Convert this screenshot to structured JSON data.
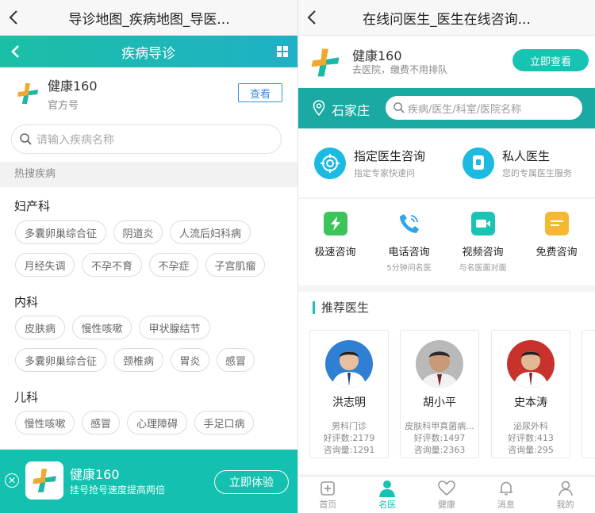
{
  "colors": {
    "teal": "#17c4b3",
    "teal_dark": "#1aa9a3",
    "link_blue": "#3d8fd6"
  },
  "left": {
    "window_title": "导诊地图_疾病地图_导医...",
    "header_title": "疾病导诊",
    "account": {
      "name": "健康160",
      "type": "官方号",
      "view_button": "查看"
    },
    "search_placeholder": "请输入疾病名称",
    "hot_search_label": "热搜疾病",
    "departments": [
      {
        "name": "妇产科",
        "tags": [
          "多囊卵巢综合征",
          "阴道炎",
          "人流后妇科病",
          "月经失调",
          "不孕不育",
          "不孕症",
          "子宫肌瘤"
        ]
      },
      {
        "name": "内科",
        "tags": [
          "皮肤病",
          "慢性咳嗽",
          "甲状腺结节",
          "多囊卵巢综合征",
          "颈椎病",
          "胃炎",
          "感冒"
        ]
      },
      {
        "name": "儿科",
        "tags": [
          "慢性咳嗽",
          "感冒",
          "心理障碍",
          "手足口病",
          "",
          ""
        ]
      }
    ],
    "banner": {
      "app_name": "健康160",
      "subtitle": "挂号抢号速度提高两倍",
      "button": "立即体验"
    }
  },
  "right": {
    "window_title": "在线问医生_医生在线咨询...",
    "app": {
      "name": "健康160",
      "subtitle": "去医院，缴费不用排队",
      "button": "立即查看"
    },
    "city": "石家庄",
    "search_placeholder": "疾病/医生/科室/医院名称",
    "consult_options": [
      {
        "title": "指定医生咨询",
        "subtitle": "指定专家快速问",
        "icon": "target-icon"
      },
      {
        "title": "私人医生",
        "subtitle": "您的专属医生服务",
        "icon": "doctor-badge-icon"
      }
    ],
    "quick_options": [
      {
        "title": "极速咨询",
        "subtitle": "",
        "icon": "lightning-icon",
        "color": "#3cc45a"
      },
      {
        "title": "电话咨询",
        "subtitle": "5分钟问名医",
        "icon": "phone-icon",
        "color": "#2fa6e8"
      },
      {
        "title": "视频咨询",
        "subtitle": "与名医面对面",
        "icon": "video-icon",
        "color": "#19c4b4"
      },
      {
        "title": "免费咨询",
        "subtitle": "",
        "icon": "chat-icon",
        "color": "#f5b82e"
      }
    ],
    "recommend_title": "推荐医生",
    "doctors": [
      {
        "name": "洪志明",
        "dept": "男科门诊",
        "rating": "好评数:2179",
        "consults": "咨询量:1291",
        "bg": "#2f7fd2"
      },
      {
        "name": "胡小平",
        "dept": "皮肤科甲真菌病...",
        "rating": "好评数:1497",
        "consults": "咨询量:2363",
        "bg": "#b9b9b9"
      },
      {
        "name": "史本涛",
        "dept": "泌尿外科",
        "rating": "好评数:413",
        "consults": "咨询量:295",
        "bg": "#c8322c"
      }
    ],
    "tabs": [
      {
        "label": "首页",
        "icon": "hospital-icon",
        "active": false
      },
      {
        "label": "名医",
        "icon": "doctor-icon",
        "active": true
      },
      {
        "label": "健康",
        "icon": "heart-icon",
        "active": false
      },
      {
        "label": "消息",
        "icon": "bell-icon",
        "active": false
      },
      {
        "label": "我的",
        "icon": "user-icon",
        "active": false
      }
    ]
  }
}
